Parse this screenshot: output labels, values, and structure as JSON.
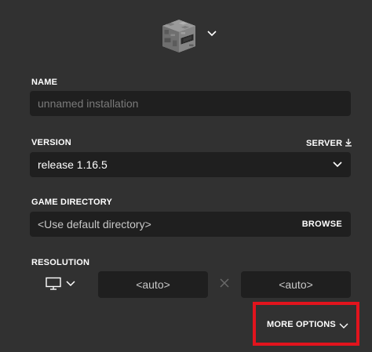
{
  "icon": {
    "name": "furnace-block-icon",
    "dropdown_icon": "chevron-down-icon"
  },
  "name_field": {
    "label": "NAME",
    "placeholder": "unnamed installation",
    "value": ""
  },
  "version_field": {
    "label": "VERSION",
    "server_label": "SERVER",
    "server_icon": "download-icon",
    "value": "release 1.16.5",
    "dropdown_icon": "chevron-down-icon"
  },
  "directory_field": {
    "label": "GAME DIRECTORY",
    "placeholder": "<Use default directory>",
    "browse_label": "BROWSE"
  },
  "resolution": {
    "label": "RESOLUTION",
    "monitor_icon": "monitor-icon",
    "width_placeholder": "<auto>",
    "height_placeholder": "<auto>",
    "separator_icon": "times-icon"
  },
  "more_options": {
    "label": "MORE OPTIONS",
    "icon": "chevron-down-icon",
    "highlight_color": "#e2141d"
  },
  "colors": {
    "background": "#313131",
    "field_background": "#1f1f1f",
    "text": "#ffffff",
    "placeholder": "#7a7a7a"
  }
}
